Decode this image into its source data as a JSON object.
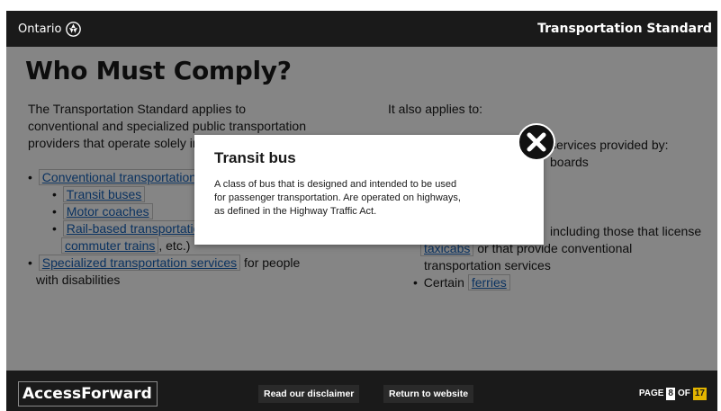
{
  "header": {
    "brand_label": "Ontario",
    "module_title": "Transportation Standard"
  },
  "main": {
    "title": "Who Must Comply?",
    "left": {
      "intro_line1": "The Transportation Standard applies to",
      "intro_line2": "conventional and specialized public transportation",
      "intro_line3": "providers that operate solely in Ontario:",
      "conventional_link": "Conventional transportation services",
      "conventional_suffix": "(",
      "transit_buses": "Transit buses",
      "motor_coaches": "Motor coaches",
      "rail_link": "Rail-based transportation",
      "commuter_trains": "commuter trains",
      "commuter_suffix": ", etc.)",
      "specialized_link": "Specialized transportation services",
      "specialized_suffix": " for people",
      "specialized_line2": "with disabilities"
    },
    "right": {
      "applies_label": "It also applies to:",
      "services_provided": "services provided by:",
      "boards_fragment": "boards",
      "licensing_fragment": "including those that license",
      "taxicabs_link": "taxicabs",
      "or_that_provide": " or that provide conventional",
      "transportation_services": "transportation services",
      "certain_label": "Certain",
      "ferries_link": "ferries"
    }
  },
  "popup": {
    "title": "Transit bus",
    "body_line1": "A class of bus that is designed and intended to be used",
    "body_line2": "for passenger transportation. Are operated on highways,",
    "body_line3": "as defined in the Highway Traffic Act."
  },
  "footer": {
    "brand": "AccessForward",
    "disclaimer_label": "Read our disclaimer",
    "return_label": "Return to website",
    "page_prefix": "PAGE",
    "page_current": "8",
    "page_of": "OF",
    "page_total": "17"
  },
  "colors": {
    "bar": "#1a1a1a",
    "link": "#1560b8",
    "page_total_badge": "#e3b500"
  },
  "icons": {
    "brand": "trillium-icon",
    "close": "close-icon"
  }
}
